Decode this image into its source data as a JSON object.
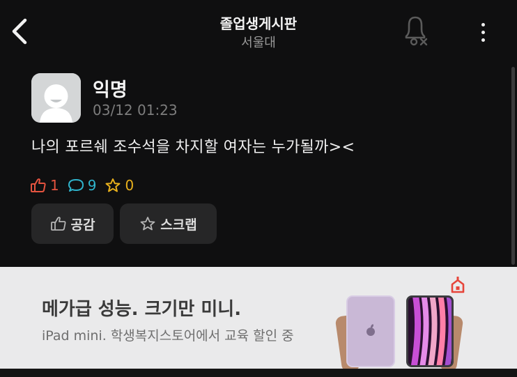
{
  "header": {
    "title": "졸업생게시판",
    "subtitle": "서울대",
    "back_icon": "chevron-left-icon",
    "bell_icon": "bell-off-icon",
    "more_icon": "more-vertical-icon"
  },
  "post": {
    "author": "익명",
    "date": "03/12 01:23",
    "content": "나의 포르쉐 조수석을 차지할 여자는 누가될까><",
    "stats": {
      "likes": "1",
      "comments": "9",
      "scraps": "0"
    },
    "buttons": {
      "like_label": "공감",
      "scrap_label": "스크랩"
    }
  },
  "ad": {
    "headline": "메가급 성능. 크기만 미니.",
    "subline": "iPad mini. 학생복지스토어에서 교육 할인 중"
  },
  "colors": {
    "background": "#0f0f10",
    "like": "#e5533f",
    "comment": "#2fb4cc",
    "scrap": "#e8b01c",
    "ad_background": "#eaeaeb",
    "ad_badge": "#e6453a"
  }
}
